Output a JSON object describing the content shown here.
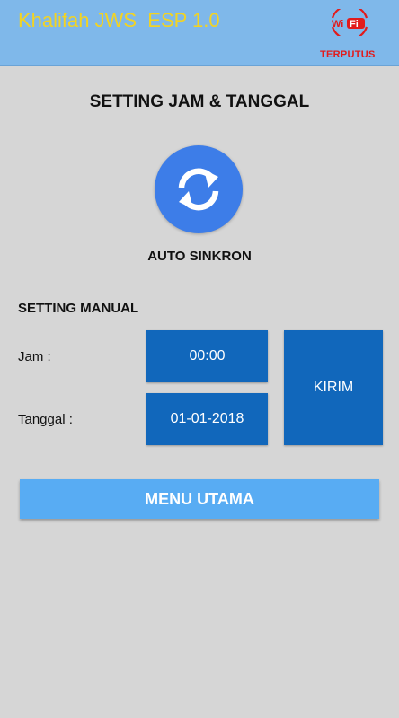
{
  "header": {
    "title": "Khalifah JWS  ESP 1.0",
    "wifi_logo_text_wi": "Wi",
    "wifi_logo_text_fi": "Fi",
    "wifi_status": "TERPUTUS",
    "colors": {
      "bar": "#7fb8ea",
      "title": "#f2d324",
      "status": "#e21b1b"
    }
  },
  "main": {
    "section_title": "SETTING JAM & TANGGAL",
    "sync": {
      "icon": "sync-icon",
      "label": "AUTO SINKRON"
    },
    "manual": {
      "title": "SETTING MANUAL",
      "time_label": "Jam :",
      "time_value": "00:00",
      "date_label": "Tanggal :",
      "date_value": "01-01-2018",
      "send_label": "KIRIM"
    },
    "menu_button": "MENU UTAMA",
    "colors": {
      "primary": "#1167bb",
      "sync": "#3d7de8",
      "menu": "#58acf3",
      "background": "#d6d6d6"
    }
  }
}
